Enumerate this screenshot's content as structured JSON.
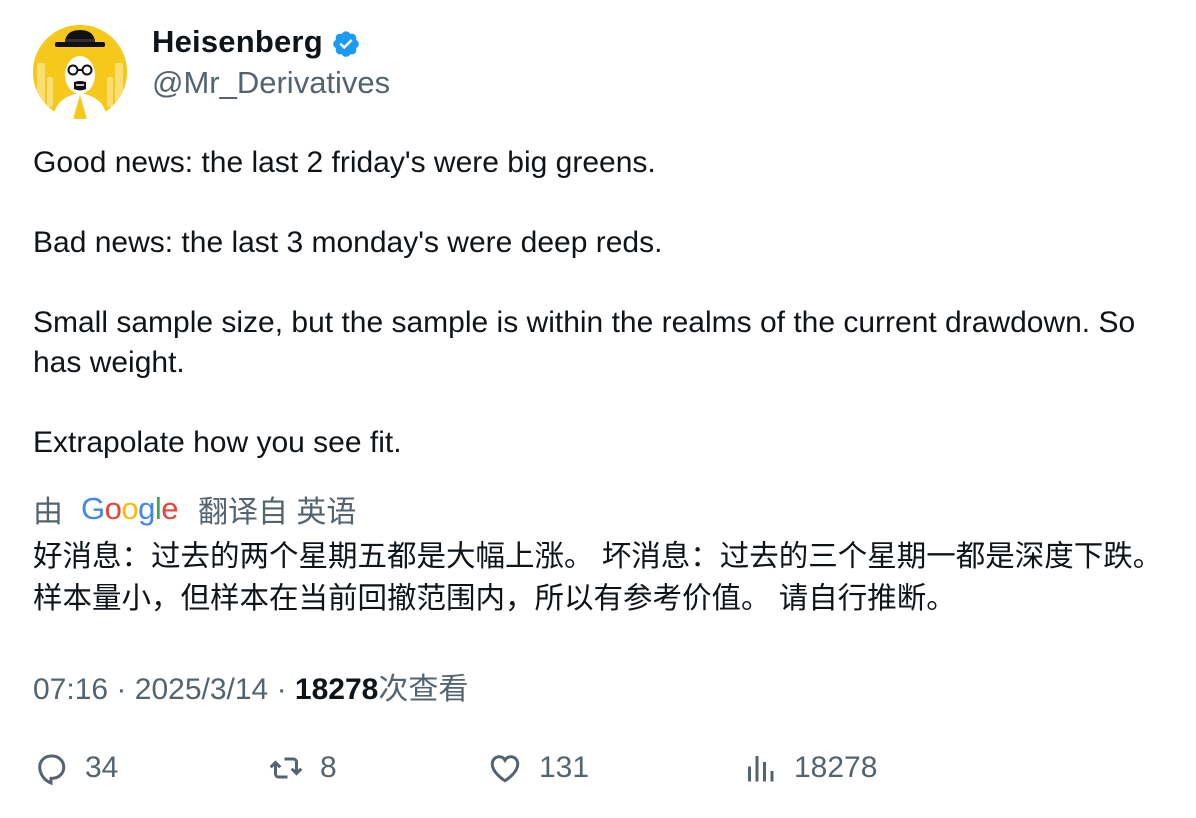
{
  "author": {
    "display_name": "Heisenberg",
    "handle": "@Mr_Derivatives",
    "verified": true,
    "avatar_icon": "heisenberg-avatar"
  },
  "tweet": {
    "paragraphs": [
      "Good news: the last 2 friday's were big greens.",
      "",
      "Bad news: the last 3 monday's were deep reds.",
      "",
      "Small sample size, but the sample is within the realms of the current drawdown. So has weight.",
      "",
      "Extrapolate how you see fit."
    ]
  },
  "translation": {
    "by_label": "由",
    "provider": "Google",
    "from_label": "翻译自 英语",
    "text": "好消息：过去的两个星期五都是大幅上涨。 坏消息：过去的三个星期一都是深度下跌。 样本量小，但样本在当前回撤范围内，所以有参考价值。 请自行推断。"
  },
  "meta": {
    "time": "07:16",
    "separator": "·",
    "date": "2025/3/14",
    "views_count": "18278",
    "views_label": "次查看"
  },
  "actions": {
    "replies": "34",
    "retweets": "8",
    "likes": "131",
    "views": "18278"
  },
  "colors": {
    "text": "#0f1419",
    "secondary": "#536471",
    "verified_blue": "#1d9bf0",
    "avatar_bg": "#f6c81c"
  }
}
